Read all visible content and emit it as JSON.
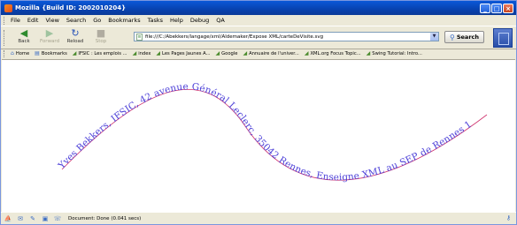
{
  "window": {
    "title": "Mozilla {Build ID: 2002010204}",
    "controls": {
      "minimize": "_",
      "maximize": "□",
      "close": "×"
    }
  },
  "menu": [
    "File",
    "Edit",
    "View",
    "Search",
    "Go",
    "Bookmarks",
    "Tasks",
    "Help",
    "Debug",
    "QA"
  ],
  "nav": {
    "back": "Back",
    "forward": "Forward",
    "reload": "Reload",
    "stop": "Stop",
    "search": "Search",
    "url": "file:///C:/Abekkers/langage/xml/Aldemaker/Expose XML/carteDeVisite.svg"
  },
  "bookmarks": [
    {
      "label": "Home",
      "icon": "home-icon"
    },
    {
      "label": "Bookmarks",
      "icon": "bookmarks-icon"
    },
    {
      "label": "IFSIC : Les emplois ...",
      "icon": "link-icon"
    },
    {
      "label": "index",
      "icon": "link-icon"
    },
    {
      "label": "Les Pages Jaunes A...",
      "icon": "link-icon"
    },
    {
      "label": "Google",
      "icon": "link-icon"
    },
    {
      "label": "Annuaire de l'univer...",
      "icon": "link-icon"
    },
    {
      "label": "XML.org Focus Topic...",
      "icon": "link-icon"
    },
    {
      "label": "Swing Tutorial: Intro...",
      "icon": "link-icon"
    }
  ],
  "document": {
    "path_text": "Yves Bekkers, IFSIC, 42 avenue Général Leclerc, 35042 Rennes, Enseigne XML au SEP de Rennes 1",
    "text_color": "#4b3fd8",
    "underline_color": "#d0336e"
  },
  "status": {
    "text": "Document: Done (0.041 secs)"
  },
  "colors": {
    "titlebar": "#0842b0",
    "chrome": "#ece9d8"
  }
}
